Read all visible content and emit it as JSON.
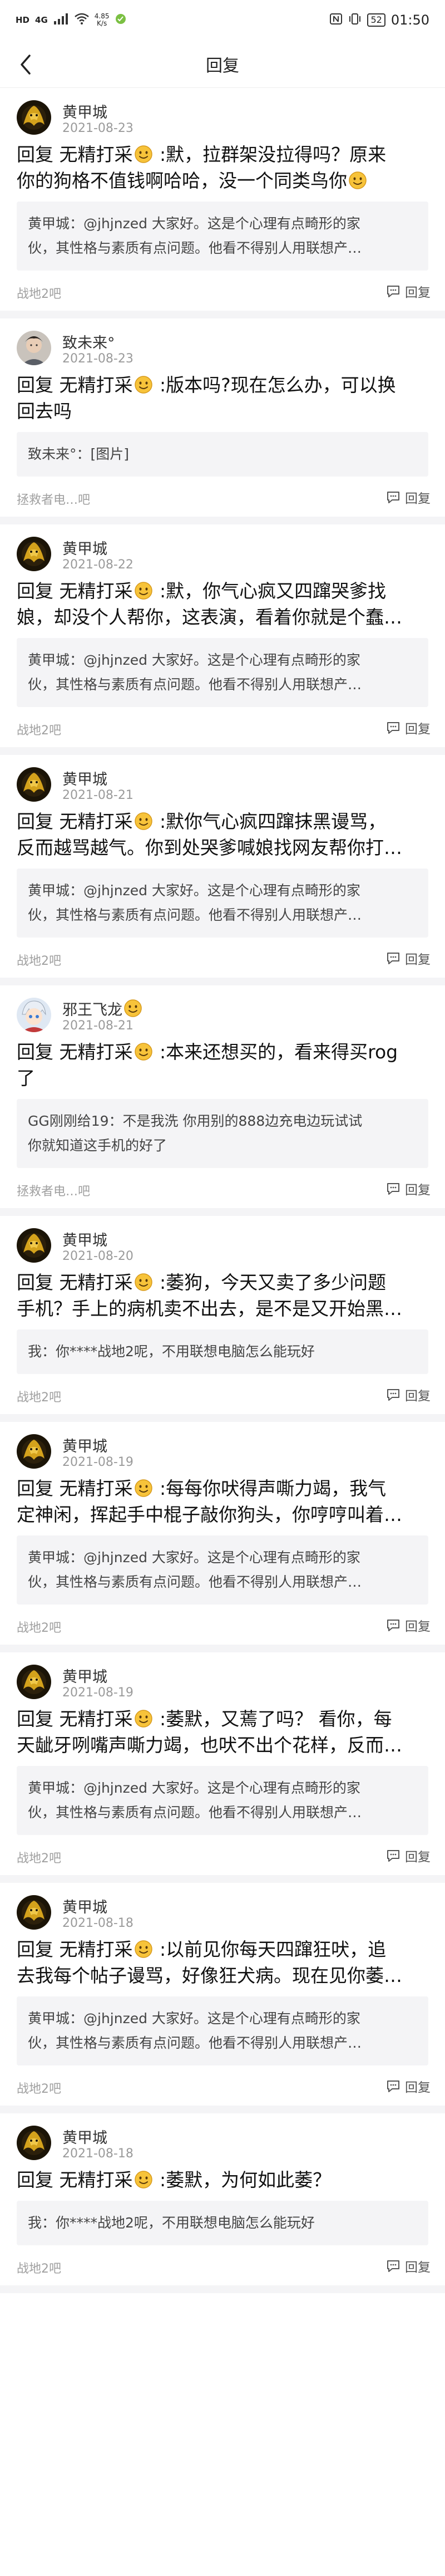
{
  "status_bar": {
    "carrier": "HD",
    "signal": "4G",
    "net_speed_value": "4.85",
    "net_speed_unit": "K/s",
    "battery": "52",
    "time": "01:50"
  },
  "nav": {
    "title": "回复"
  },
  "quote_prefix": "回复 无精打采",
  "posts": [
    {
      "user": "黄甲城",
      "date": "2021-08-23",
      "avatar": "gold",
      "lines": [
        "回复 无精打采{e} :默，拉群架没拉得吗？原来",
        "你的狗格不值钱啊哈哈，没一个同类鸟你{e}"
      ],
      "quote": [
        "黄甲城：@jhjnzed 大家好。这是个心理有点畸形的家",
        "伙，其性格与素质有点问题。他看不得别人用联想产…"
      ],
      "source": "战地2吧",
      "reply": "回复"
    },
    {
      "user": "致未来°",
      "date": "2021-08-23",
      "avatar": "face",
      "lines": [
        "回复 无精打采{e} :版本吗?现在怎么办，可以换",
        "回去吗"
      ],
      "quote": [
        "致未来°：[图片]"
      ],
      "source": "拯救者电…吧",
      "reply": "回复"
    },
    {
      "user": "黄甲城",
      "date": "2021-08-22",
      "avatar": "gold",
      "lines": [
        "回复 无精打采{e} :默，你气心疯又四蹿哭爹找",
        "娘，却没个人帮你，这表演，看着你就是个蠢…"
      ],
      "quote": [
        "黄甲城：@jhjnzed 大家好。这是个心理有点畸形的家",
        "伙，其性格与素质有点问题。他看不得别人用联想产…"
      ],
      "source": "战地2吧",
      "reply": "回复"
    },
    {
      "user": "黄甲城",
      "date": "2021-08-21",
      "avatar": "gold",
      "lines": [
        "回复 无精打采{e} :默你气心疯四蹿抹黑谩骂，",
        "反而越骂越气。你到处哭爹喊娘找网友帮你打…"
      ],
      "quote": [
        "黄甲城：@jhjnzed 大家好。这是个心理有点畸形的家",
        "伙，其性格与素质有点问题。他看不得别人用联想产…"
      ],
      "source": "战地2吧",
      "reply": "回复"
    },
    {
      "user": "邪王飞龙{e}",
      "date": "2021-08-21",
      "avatar": "anime",
      "lines": [
        "回复 无精打采{e} :本来还想买的，看来得买rog",
        "了"
      ],
      "quote": [
        "GG刚刚给19：不是我洗 你用别的888边充电边玩试试",
        "你就知道这手机的好了"
      ],
      "source": "拯救者电…吧",
      "reply": "回复"
    },
    {
      "user": "黄甲城",
      "date": "2021-08-20",
      "avatar": "gold",
      "lines": [
        "回复 无精打采{e} :萎狗，今天又卖了多少问题",
        "手机？手上的病机卖不出去，是不是又开始黑…"
      ],
      "quote": [
        "我：你****战地2呢，不用联想电脑怎么能玩好"
      ],
      "source": "战地2吧",
      "reply": "回复"
    },
    {
      "user": "黄甲城",
      "date": "2021-08-19",
      "avatar": "gold",
      "lines": [
        "回复 无精打采{e} :每每你吠得声嘶力竭，我气",
        "定神闲，挥起手中棍子敲你狗头，你哼哼叫着…"
      ],
      "quote": [
        "黄甲城：@jhjnzed 大家好。这是个心理有点畸形的家",
        "伙，其性格与素质有点问题。他看不得别人用联想产…"
      ],
      "source": "战地2吧",
      "reply": "回复"
    },
    {
      "user": "黄甲城",
      "date": "2021-08-19",
      "avatar": "gold",
      "lines": [
        "回复 无精打采{e} :萎默，又蔫了吗？ 看你，每",
        "天龇牙咧嘴声嘶力竭，也吠不出个花样，反而…"
      ],
      "quote": [
        "黄甲城：@jhjnzed 大家好。这是个心理有点畸形的家",
        "伙，其性格与素质有点问题。他看不得别人用联想产…"
      ],
      "source": "战地2吧",
      "reply": "回复"
    },
    {
      "user": "黄甲城",
      "date": "2021-08-18",
      "avatar": "gold",
      "lines": [
        "回复 无精打采{e} :以前见你每天四蹿狂吠，追",
        "去我每个帖子谩骂，好像狂犬病。现在见你萎…"
      ],
      "quote": [
        "黄甲城：@jhjnzed 大家好。这是个心理有点畸形的家",
        "伙，其性格与素质有点问题。他看不得别人用联想产…"
      ],
      "source": "战地2吧",
      "reply": "回复"
    },
    {
      "user": "黄甲城",
      "date": "2021-08-18",
      "avatar": "gold",
      "lines": [
        "回复 无精打采{e} :萎默，为何如此萎？"
      ],
      "quote": [
        "我：你****战地2呢，不用联想电脑怎么能玩好"
      ],
      "source": "战地2吧",
      "reply": "回复"
    }
  ]
}
